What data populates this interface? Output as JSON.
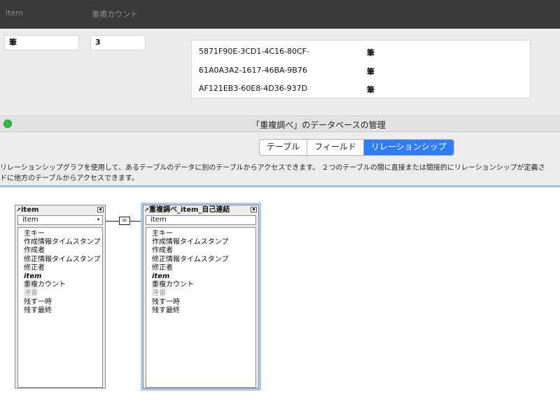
{
  "header": {
    "col_item": "item",
    "col_count": "重複カウント"
  },
  "form": {
    "item_value": "筆",
    "count_value": "3"
  },
  "portal": {
    "rows": [
      {
        "id": "5871F90E-3CD1-4C16-80CF-",
        "value": "筆"
      },
      {
        "id": "61A0A3A2-1617-46BA-9B76",
        "value": "筆"
      },
      {
        "id": "AF121EB3-60E8-4D36-937D",
        "value": "筆"
      }
    ]
  },
  "window": {
    "title": "「重複調べ」のデータベースの管理",
    "status_color": "#2fbf45"
  },
  "tabs": [
    {
      "label": "テーブル",
      "active": false
    },
    {
      "label": "フィールド",
      "active": false
    },
    {
      "label": "リレーションシップ",
      "active": true
    }
  ],
  "description": {
    "line1": "リレーションシップグラフを使用して、あるテーブルのデータに別のテーブルからアクセスできます。 ２つのテーブルの間に直接または間接的にリレーションシップが定義さ",
    "line2": "ドに他方のテーブルからアクセスできます。"
  },
  "graph": {
    "relation_symbol": "=",
    "left_table": {
      "name": "item",
      "key": "item",
      "fields": [
        "主キー",
        "作成情報タイムスタンプ",
        "作成者",
        "修正情報タイムスタンプ",
        "修正者",
        "item",
        "重複カウント",
        "連番",
        "残す一時",
        "残す最終"
      ]
    },
    "right_table": {
      "name": "重複調べ_item_自己連結",
      "key": "item",
      "fields": [
        "主キー",
        "作成情報タイムスタンプ",
        "作成者",
        "修正情報タイムスタンプ",
        "修正者",
        "item",
        "重複カウント",
        "連番",
        "残す一時",
        "残す最終"
      ]
    }
  },
  "colors": {
    "accent": "#2f7ef7",
    "selection": "#a9cdf0",
    "header_bg": "#3a3a3a"
  }
}
